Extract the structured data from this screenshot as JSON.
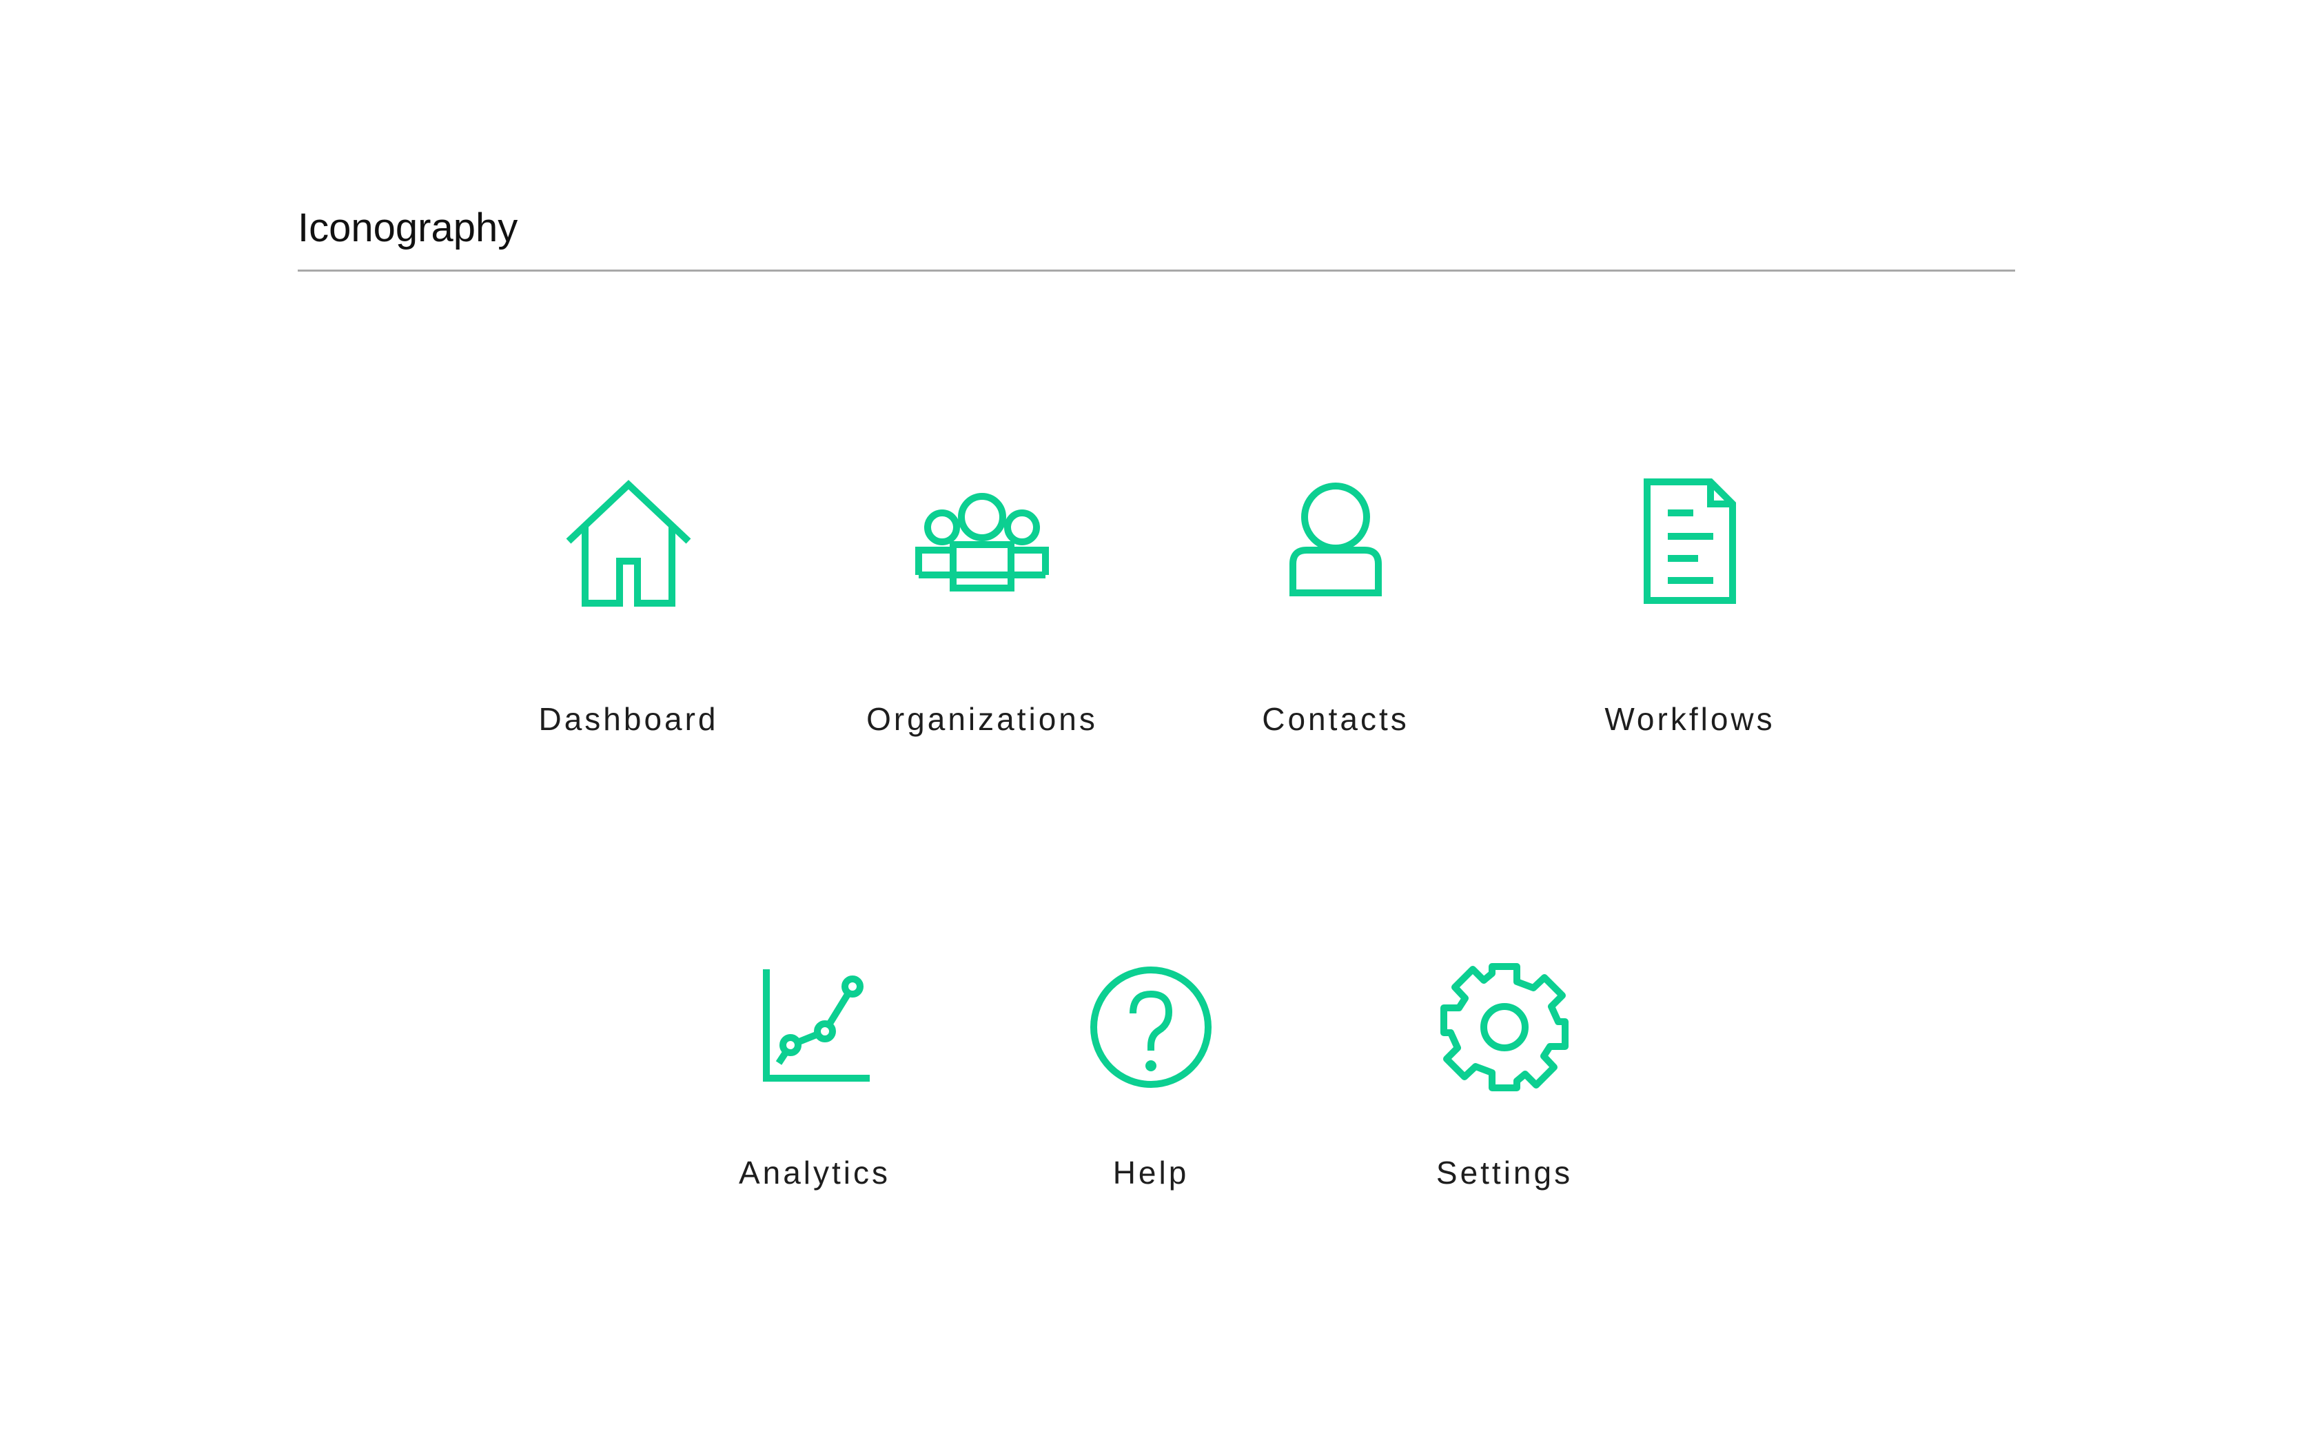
{
  "section": {
    "title": "Iconography"
  },
  "accent_color": "#0ccf91",
  "icons": [
    {
      "label": "Dashboard",
      "icon": "home-icon"
    },
    {
      "label": "Organizations",
      "icon": "users-group-icon"
    },
    {
      "label": "Contacts",
      "icon": "user-icon"
    },
    {
      "label": "Workflows",
      "icon": "document-icon"
    },
    {
      "label": "Analytics",
      "icon": "chart-icon"
    },
    {
      "label": "Help",
      "icon": "help-icon"
    },
    {
      "label": "Settings",
      "icon": "gear-icon"
    }
  ]
}
